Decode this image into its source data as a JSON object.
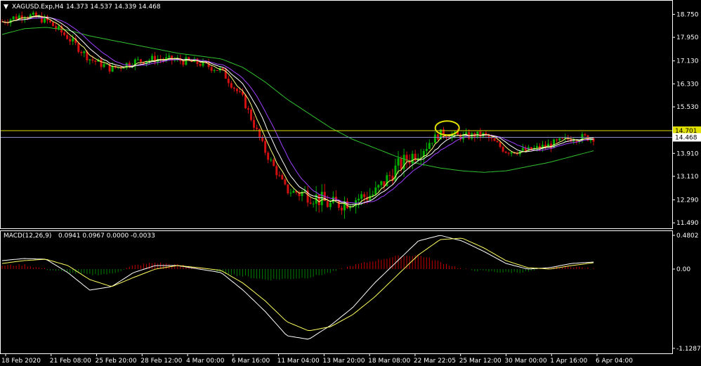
{
  "header": {
    "symbol_label": "XAGUSD.Exp,H4",
    "ohlc_text": "14.373 14.537 14.339 14.468"
  },
  "macd_header": {
    "label": "MACD(12,26,9)",
    "values_text": "0.0941 0.0967 0.0000 -0.0033"
  },
  "colors": {
    "background": "#000000",
    "frame": "#ffffff",
    "bull_candle": "#00b000",
    "bear_candle": "#d01010",
    "ma_fast": "#ffff80",
    "ma_mid": "#ffffff",
    "ma_slow": "#a040ff",
    "ma_long": "#30c030",
    "resistance_line": "#e0e000",
    "price_line": "#8c8cc8",
    "macd_line": "#ffffff",
    "signal_line": "#ffff60",
    "hist_pos": "#c00000",
    "hist_neg": "#008000",
    "circle": "#e0e000"
  },
  "chart_data": {
    "type": "candlestick",
    "main": {
      "ylim": [
        11.3,
        19.25
      ],
      "y_ticks": [
        "18.750",
        "17.950",
        "17.130",
        "16.330",
        "15.530",
        "14.701",
        "14.468",
        "13.910",
        "13.110",
        "12.290",
        "11.490"
      ],
      "y_tick_values": [
        18.75,
        17.95,
        17.13,
        16.33,
        15.53,
        14.701,
        14.468,
        13.91,
        13.11,
        12.29,
        11.49
      ],
      "highlighted_ticks": [
        "14.701",
        "14.468"
      ],
      "horizontal_lines": [
        {
          "value": 14.701,
          "role": "resistance"
        },
        {
          "value": 14.468,
          "role": "current-price"
        }
      ],
      "annotation": {
        "type": "ellipse",
        "around_date": "24 Mar 20:00",
        "value": 14.72
      },
      "close_path": [
        {
          "date": "18 Feb 2020",
          "close": 18.5
        },
        {
          "date": "21 Feb 08:00",
          "close": 18.75
        },
        {
          "date": "22 Feb",
          "close": 18.55
        },
        {
          "date": "25 Feb 20:00",
          "close": 17.95
        },
        {
          "date": "27 Feb",
          "close": 17.2
        },
        {
          "date": "28 Feb 12:00",
          "close": 16.85
        },
        {
          "date": "2 Mar",
          "close": 17.1
        },
        {
          "date": "4 Mar 00:00",
          "close": 17.2
        },
        {
          "date": "6 Mar 16:00",
          "close": 17.15
        },
        {
          "date": "9 Mar",
          "close": 17.05
        },
        {
          "date": "11 Mar 04:00",
          "close": 16.8
        },
        {
          "date": "12 Mar",
          "close": 15.8
        },
        {
          "date": "13 Mar 00:00",
          "close": 14.0
        },
        {
          "date": "13 Mar 20:00",
          "close": 12.6
        },
        {
          "date": "16 Mar",
          "close": 12.5
        },
        {
          "date": "18 Mar 08:00",
          "close": 12.1
        },
        {
          "date": "19 Mar",
          "close": 12.3
        },
        {
          "date": "20 Mar",
          "close": 12.5
        },
        {
          "date": "22 Mar 22:05",
          "close": 13.4
        },
        {
          "date": "23 Mar",
          "close": 14.0
        },
        {
          "date": "24 Mar 20:00",
          "close": 14.6
        },
        {
          "date": "25 Mar 12:00",
          "close": 14.5
        },
        {
          "date": "27 Mar",
          "close": 14.55
        },
        {
          "date": "30 Mar 00:00",
          "close": 14.0
        },
        {
          "date": "31 Mar",
          "close": 14.0
        },
        {
          "date": "1 Apr 16:00",
          "close": 14.2
        },
        {
          "date": "3 Apr",
          "close": 14.45
        },
        {
          "date": "6 Apr 04:00",
          "close": 14.468
        }
      ],
      "ma_long_path": [
        18.05,
        18.25,
        18.3,
        18.2,
        18.0,
        17.85,
        17.7,
        17.55,
        17.4,
        17.3,
        17.2,
        16.9,
        16.4,
        15.8,
        15.3,
        14.8,
        14.4,
        14.1,
        13.8,
        13.55,
        13.4,
        13.3,
        13.25,
        13.3,
        13.45,
        13.6,
        13.8,
        14.0
      ]
    },
    "macd": {
      "label": "MACD(12,26,9)",
      "ylim": [
        -1.2,
        0.55
      ],
      "y_ticks": [
        "0.4802",
        "0.00",
        "-1.1287"
      ],
      "y_tick_values": [
        0.4802,
        0.0,
        -1.1287
      ],
      "hist_path": [
        0.05,
        0.06,
        0.0,
        -0.05,
        -0.08,
        -0.07,
        0.05,
        0.09,
        0.06,
        0.02,
        -0.05,
        -0.1,
        -0.15,
        -0.14,
        -0.12,
        -0.05,
        0.05,
        0.12,
        0.18,
        0.2,
        0.1,
        0.0,
        -0.03,
        -0.05,
        -0.04,
        0.02,
        0.04,
        0.0
      ],
      "macd_path": [
        0.12,
        0.15,
        0.14,
        -0.05,
        -0.3,
        -0.25,
        -0.05,
        0.05,
        0.05,
        0.0,
        -0.05,
        -0.3,
        -0.6,
        -0.95,
        -1.0,
        -0.8,
        -0.55,
        -0.2,
        0.1,
        0.4,
        0.48,
        0.4,
        0.25,
        0.08,
        0.0,
        0.02,
        0.08,
        0.1
      ],
      "signal_path": [
        0.08,
        0.12,
        0.14,
        0.05,
        -0.15,
        -0.25,
        -0.12,
        0.0,
        0.05,
        0.02,
        -0.02,
        -0.2,
        -0.45,
        -0.75,
        -0.88,
        -0.82,
        -0.65,
        -0.4,
        -0.1,
        0.2,
        0.42,
        0.44,
        0.3,
        0.12,
        0.02,
        0.0,
        0.05,
        0.09
      ]
    },
    "x_ticks": [
      "18 Feb 2020",
      "21 Feb 08:00",
      "25 Feb 20:00",
      "28 Feb 12:00",
      "4 Mar 00:00",
      "6 Mar 16:00",
      "11 Mar 04:00",
      "13 Mar 20:00",
      "18 Mar 08:00",
      "22 Mar 22:05",
      "25 Mar 12:00",
      "30 Mar 00:00",
      "1 Apr 16:00",
      "6 Apr 04:00"
    ]
  }
}
